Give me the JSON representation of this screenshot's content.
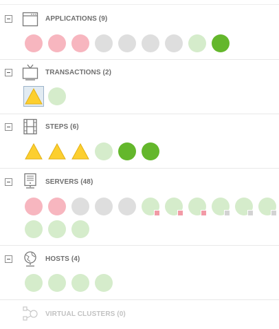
{
  "colors": {
    "critical_red": "#f7b6bf",
    "unknown_gray": "#dedede",
    "normal_light_green": "#d5eccb",
    "normal_dark_green": "#64b72c",
    "warning_yellow": "#fccf2f",
    "selected_background": "#e2ebf2"
  },
  "sections": [
    {
      "title": "APPLICATIONS (9)",
      "icon": "application-window-icon",
      "items": [
        {
          "shape": "circle",
          "status": "red"
        },
        {
          "shape": "circle",
          "status": "red"
        },
        {
          "shape": "circle",
          "status": "red"
        },
        {
          "shape": "circle",
          "status": "gray"
        },
        {
          "shape": "circle",
          "status": "gray"
        },
        {
          "shape": "circle",
          "status": "gray"
        },
        {
          "shape": "circle",
          "status": "gray"
        },
        {
          "shape": "circle",
          "status": "light-green"
        },
        {
          "shape": "circle",
          "status": "dark-green"
        }
      ]
    },
    {
      "title": "TRANSACTIONS (2)",
      "icon": "tv-icon",
      "items": [
        {
          "shape": "triangle",
          "status": "yellow",
          "selected": true
        },
        {
          "shape": "circle",
          "status": "light-green"
        }
      ]
    },
    {
      "title": "STEPS (6)",
      "icon": "film-strip-icon",
      "items": [
        {
          "shape": "triangle",
          "status": "yellow"
        },
        {
          "shape": "triangle",
          "status": "yellow"
        },
        {
          "shape": "triangle",
          "status": "yellow"
        },
        {
          "shape": "circle",
          "status": "light-green"
        },
        {
          "shape": "circle",
          "status": "dark-green"
        },
        {
          "shape": "circle",
          "status": "dark-green"
        }
      ]
    },
    {
      "title": "SERVERS (48)",
      "icon": "server-tower-icon",
      "items": [
        {
          "shape": "circle",
          "status": "red"
        },
        {
          "shape": "circle",
          "status": "red"
        },
        {
          "shape": "circle",
          "status": "gray"
        },
        {
          "shape": "circle",
          "status": "gray"
        },
        {
          "shape": "circle",
          "status": "gray"
        },
        {
          "shape": "circle",
          "status": "light-green",
          "badge": "pink"
        },
        {
          "shape": "circle",
          "status": "light-green",
          "badge": "pink"
        },
        {
          "shape": "circle",
          "status": "light-green",
          "badge": "pink"
        },
        {
          "shape": "circle",
          "status": "light-green",
          "badge": "grey"
        },
        {
          "shape": "circle",
          "status": "light-green",
          "badge": "grey"
        },
        {
          "shape": "circle",
          "status": "light-green",
          "badge": "grey"
        },
        {
          "shape": "circle",
          "status": "light-green"
        },
        {
          "shape": "circle",
          "status": "light-green"
        },
        {
          "shape": "circle",
          "status": "light-green"
        }
      ]
    },
    {
      "title": "HOSTS (4)",
      "icon": "globe-host-icon",
      "items": [
        {
          "shape": "circle",
          "status": "light-green"
        },
        {
          "shape": "circle",
          "status": "light-green"
        },
        {
          "shape": "circle",
          "status": "light-green"
        },
        {
          "shape": "circle",
          "status": "light-green"
        }
      ]
    },
    {
      "title": "VIRTUAL CLUSTERS (0)",
      "icon": "virtual-cluster-icon",
      "items": []
    }
  ]
}
